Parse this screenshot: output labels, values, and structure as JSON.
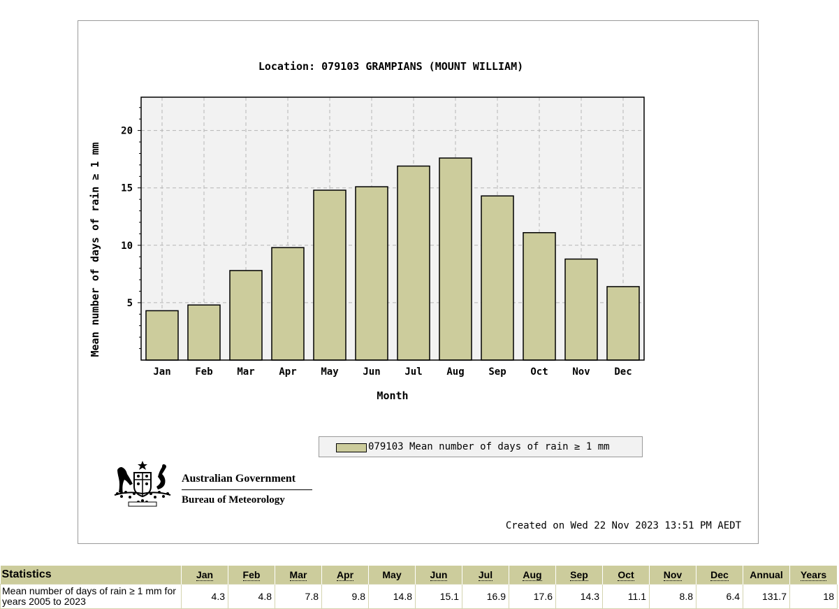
{
  "chart_data": {
    "type": "bar",
    "title": "Location: 079103 GRAMPIANS (MOUNT WILLIAM)",
    "xlabel": "Month",
    "ylabel": "Mean number of days of rain ≥ 1 mm",
    "categories": [
      "Jan",
      "Feb",
      "Mar",
      "Apr",
      "May",
      "Jun",
      "Jul",
      "Aug",
      "Sep",
      "Oct",
      "Nov",
      "Dec"
    ],
    "series": [
      {
        "name": "079103 Mean number of days of rain ≥ 1 mm",
        "values": [
          4.3,
          4.8,
          7.8,
          9.8,
          14.8,
          15.1,
          16.9,
          17.6,
          14.3,
          11.1,
          8.8,
          6.4
        ]
      }
    ],
    "ylim": [
      0,
      22.9
    ],
    "yticks": [
      "5",
      "10",
      "15",
      "20"
    ],
    "ytick_values": [
      5,
      10,
      15,
      20
    ],
    "grid": true,
    "legend_placement": "bottom-right",
    "bar_color": "#cccc9c",
    "plot_background": "#f2f2f2"
  },
  "footer": {
    "agency_line1": "Australian Government",
    "agency_line2": "Bureau of Meteorology",
    "created": "Created on Wed 22 Nov 2023 13:51 PM AEDT"
  },
  "stats_table": {
    "header_label": "Statistics",
    "columns": [
      "Jan",
      "Feb",
      "Mar",
      "Apr",
      "May",
      "Jun",
      "Jul",
      "Aug",
      "Sep",
      "Oct",
      "Nov",
      "Dec",
      "Annual",
      "Years"
    ],
    "row_label": "Mean number of days of rain ≥ 1 mm for years 2005 to 2023",
    "row_values": [
      "4.3",
      "4.8",
      "7.8",
      "9.8",
      "14.8",
      "15.1",
      "16.9",
      "17.6",
      "14.3",
      "11.1",
      "8.8",
      "6.4",
      "131.7",
      "18"
    ],
    "header_color": "#cccc9c"
  }
}
